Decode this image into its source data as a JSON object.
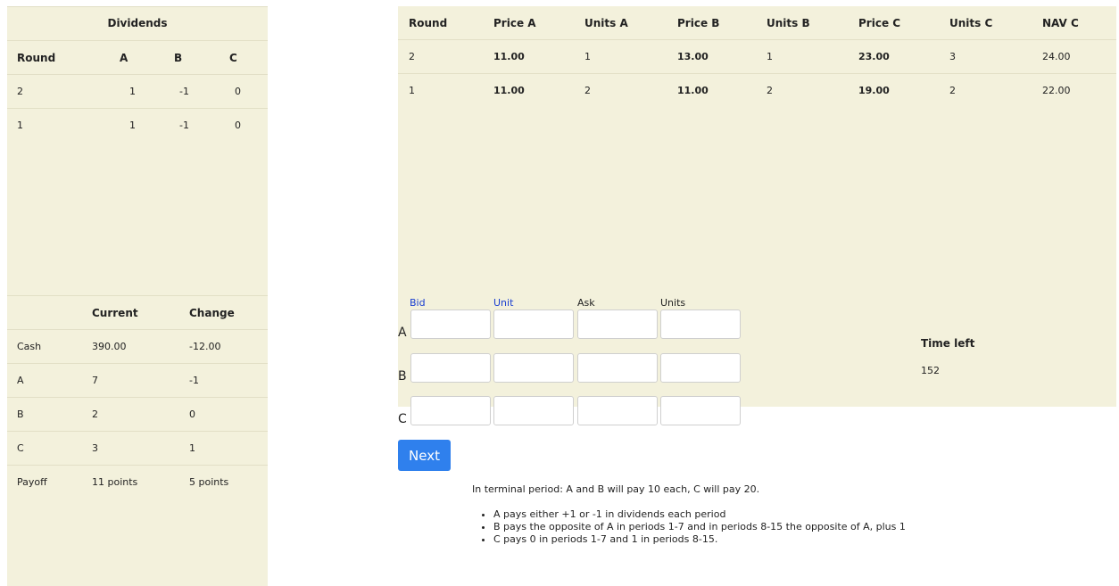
{
  "dividends": {
    "title": "Dividends",
    "headers": [
      "Round",
      "A",
      "B",
      "C"
    ],
    "rows": [
      [
        "2",
        "1",
        "-1",
        "0"
      ],
      [
        "1",
        "1",
        "-1",
        "0"
      ]
    ]
  },
  "holdings": {
    "headers": [
      "",
      "Current",
      "Change"
    ],
    "rows": [
      [
        "Cash",
        "390.00",
        "-12.00"
      ],
      [
        "A",
        "7",
        "-1"
      ],
      [
        "B",
        "2",
        "0"
      ],
      [
        "C",
        "3",
        "1"
      ],
      [
        "Payoff",
        "11 points",
        "5 points"
      ]
    ]
  },
  "history": {
    "headers": [
      "Round",
      "Price A",
      "Units A",
      "Price B",
      "Units B",
      "Price C",
      "Units C",
      "NAV C"
    ],
    "rows": [
      [
        "2",
        "11.00",
        "1",
        "13.00",
        "1",
        "23.00",
        "3",
        "24.00"
      ],
      [
        "1",
        "11.00",
        "2",
        "11.00",
        "2",
        "19.00",
        "2",
        "22.00"
      ]
    ]
  },
  "trade": {
    "columns": [
      "Bid",
      "Unit",
      "Ask",
      "Units"
    ],
    "assets": [
      "A",
      "B",
      "C"
    ]
  },
  "timer": {
    "label": "Time left",
    "value": "152"
  },
  "next_label": "Next",
  "rules": {
    "intro": "In terminal period: A and B will pay 10 each, C will pay 20.",
    "bullets": [
      "A pays either +1 or -1 in dividends each period",
      "B pays the opposite of A in periods 1-7 and in periods 8-15 the opposite of A, plus 1",
      "C pays 0 in periods 1-7 and 1 in periods 8-15."
    ]
  },
  "colors": {
    "panel": "#f3f1dc",
    "next_button": "#2f80ed",
    "bid_label": "#1a3fd1"
  }
}
